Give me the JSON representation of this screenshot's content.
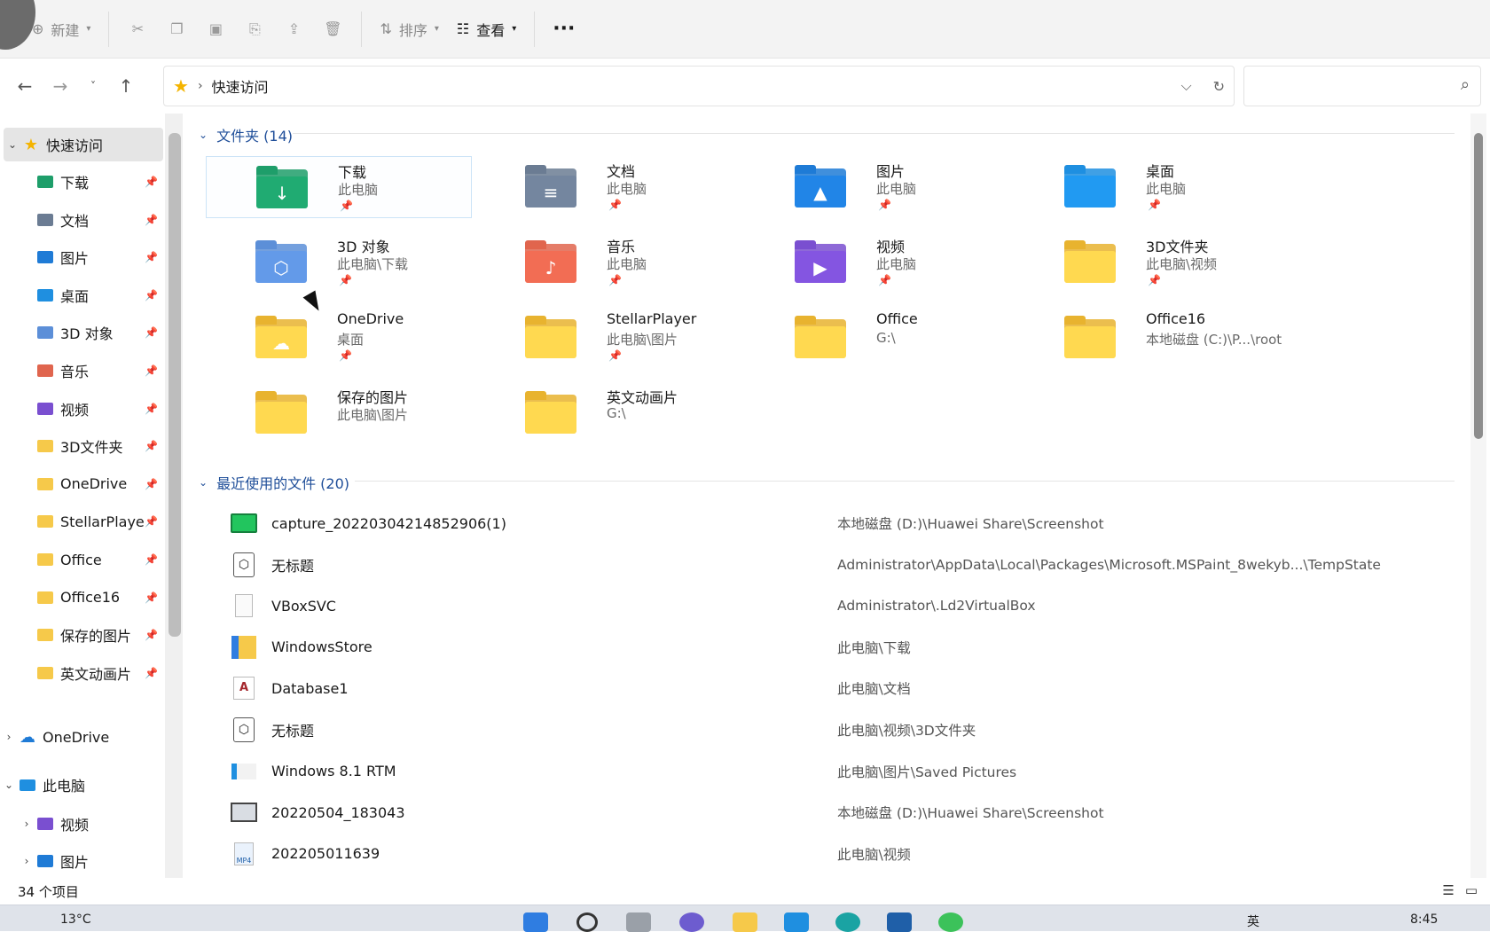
{
  "toolbar": {
    "new_label": "新建",
    "sort_label": "排序",
    "view_label": "查看",
    "more_label": "···"
  },
  "address": {
    "path": "快速访问"
  },
  "sidebar": {
    "quick_access": "快速访问",
    "items": [
      {
        "label": "下载"
      },
      {
        "label": "文档"
      },
      {
        "label": "图片"
      },
      {
        "label": "桌面"
      },
      {
        "label": "3D 对象"
      },
      {
        "label": "音乐"
      },
      {
        "label": "视频"
      },
      {
        "label": "3D文件夹"
      },
      {
        "label": "OneDrive"
      },
      {
        "label": "StellarPlaye"
      },
      {
        "label": "Office"
      },
      {
        "label": "Office16"
      },
      {
        "label": "保存的图片"
      },
      {
        "label": "英文动画片"
      }
    ],
    "onedrive": "OneDrive",
    "this_pc": "此电脑",
    "pc_children": [
      {
        "label": "视频"
      },
      {
        "label": "图片"
      }
    ]
  },
  "folders_group": {
    "title": "文件夹 (14)",
    "items": [
      {
        "name": "下载",
        "sub": "此电脑",
        "pinned": true,
        "color": "#1e9e6a",
        "glyph": "↓"
      },
      {
        "name": "文档",
        "sub": "此电脑",
        "pinned": true,
        "color": "#6b7c93",
        "glyph": "≡"
      },
      {
        "name": "图片",
        "sub": "此电脑",
        "pinned": true,
        "color": "#1f7bd6",
        "glyph": "▲"
      },
      {
        "name": "桌面",
        "sub": "此电脑",
        "pinned": true,
        "color": "#1f8fe0",
        "glyph": ""
      },
      {
        "name": "3D 对象",
        "sub": "此电脑\\下载",
        "pinned": true,
        "color": "#5c8fd8",
        "glyph": "⬡"
      },
      {
        "name": "音乐",
        "sub": "此电脑",
        "pinned": true,
        "color": "#e0654e",
        "glyph": "♪"
      },
      {
        "name": "视频",
        "sub": "此电脑",
        "pinned": true,
        "color": "#7a4fd0",
        "glyph": "▶"
      },
      {
        "name": "3D文件夹",
        "sub": "此电脑\\视频",
        "pinned": true,
        "color": "#f6c94a",
        "glyph": ""
      },
      {
        "name": "OneDrive",
        "sub": "桌面",
        "pinned": true,
        "color": "#f6c94a",
        "glyph": "☁"
      },
      {
        "name": "StellarPlayer",
        "sub": "此电脑\\图片",
        "pinned": true,
        "color": "#f6c94a",
        "glyph": ""
      },
      {
        "name": "Office",
        "sub": "G:\\",
        "pinned": false,
        "color": "#f6c94a",
        "glyph": ""
      },
      {
        "name": "Office16",
        "sub": "本地磁盘 (C:)\\P...\\root",
        "pinned": false,
        "color": "#f6c94a",
        "glyph": ""
      },
      {
        "name": "保存的图片",
        "sub": "此电脑\\图片",
        "pinned": false,
        "color": "#f6c94a",
        "glyph": ""
      },
      {
        "name": "英文动画片",
        "sub": "G:\\",
        "pinned": false,
        "color": "#f6c94a",
        "glyph": ""
      }
    ]
  },
  "recent_group": {
    "title": "最近使用的文件 (20)",
    "files": [
      {
        "name": "capture_20220304214852906(1)",
        "path": "本地磁盘 (D:)\\Huawei Share\\Screenshot",
        "icon": "image-green"
      },
      {
        "name": "无标题",
        "path": "Administrator\\AppData\\Local\\Packages\\Microsoft.MSPaint_8wekyb...\\TempState",
        "icon": "3d-cube"
      },
      {
        "name": "VBoxSVC",
        "path": "Administrator\\.Ld2VirtualBox",
        "icon": "blank-doc"
      },
      {
        "name": "WindowsStore",
        "path": "此电脑\\下载",
        "icon": "archive"
      },
      {
        "name": "Database1",
        "path": "此电脑\\文档",
        "icon": "access-db"
      },
      {
        "name": "无标题",
        "path": "此电脑\\视频\\3D文件夹",
        "icon": "3d-cube"
      },
      {
        "name": "Windows  8.1 RTM",
        "path": "此电脑\\图片\\Saved Pictures",
        "icon": "image-small"
      },
      {
        "name": "20220504_183043",
        "path": "本地磁盘 (D:)\\Huawei Share\\Screenshot",
        "icon": "video-frame"
      },
      {
        "name": "202205011639",
        "path": "此电脑\\视频",
        "icon": "mp4"
      }
    ]
  },
  "status": {
    "count": "34 个项目"
  },
  "taskbar": {
    "weather": "13°C",
    "ime": "英",
    "time": "8:45"
  }
}
